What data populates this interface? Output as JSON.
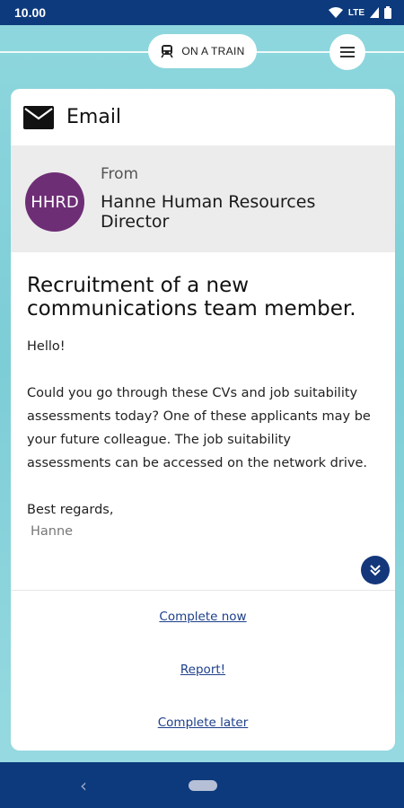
{
  "status_bar": {
    "time": "10.00",
    "network": "LTE",
    "icons": [
      "wifi-icon",
      "signal-icon",
      "battery-icon"
    ]
  },
  "top": {
    "location_label": "ON A TRAIN",
    "location_icon": "train-icon",
    "menu_icon": "menu-icon"
  },
  "card": {
    "title": "Email",
    "title_icon": "envelope-icon",
    "from_label": "From",
    "sender_initials": "HHRD",
    "sender_name": "Hanne Human Resources Director",
    "subject": "Recruitment of a new communications team member.",
    "greeting": "Hello!",
    "body": "Could you go through these CVs and job suitability assessments today? One of these applicants may be your future colleague. The job suitability assessments can be accessed on the network drive.",
    "closing": "Best regards,",
    "signature": "Hanne",
    "scroll_icon": "double-chevron-down-icon"
  },
  "actions": {
    "complete_now": "Complete now",
    "report": "Report!",
    "complete_later": "Complete later"
  },
  "colors": {
    "primary": "#0d3a7c",
    "background": "#8fd7de",
    "avatar": "#6e2e76",
    "link": "#1d3f8a"
  }
}
